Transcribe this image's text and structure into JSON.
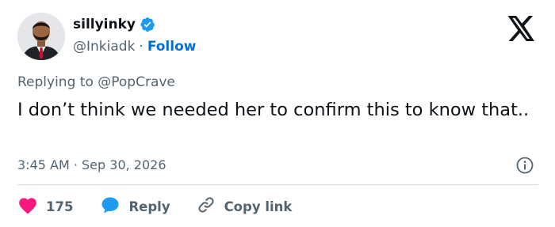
{
  "user": {
    "display_name": "sillyinky",
    "handle": "@Inkiadk",
    "separator": "·",
    "follow_label": "Follow"
  },
  "reply_context": {
    "prefix": "Replying to",
    "mention": "@PopCrave"
  },
  "tweet": {
    "text": "I don’t think we needed her to confirm this to know that..",
    "timestamp": "3:45 AM · Sep 30, 2026"
  },
  "actions": {
    "like_count": "175",
    "reply_label": "Reply",
    "copy_link_label": "Copy link"
  },
  "colors": {
    "like": "#f91880",
    "reply": "#1d9bf0",
    "verified": "#1d9bf0",
    "follow": "#006fd6",
    "muted": "#536471"
  },
  "icons": {
    "verified": "verified-badge-icon",
    "brand": "x-logo-icon",
    "info": "info-icon",
    "like": "heart-icon",
    "reply": "speech-bubble-icon",
    "copy_link": "link-icon"
  }
}
